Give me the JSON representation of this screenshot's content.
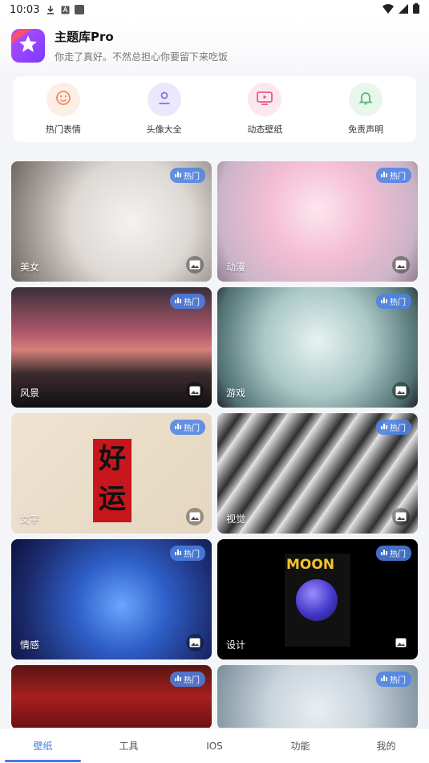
{
  "status_bar": {
    "time": "10:03"
  },
  "header": {
    "app_title": "主题库Pro",
    "subtitle": "你走了真好。不然总担心你要留下来吃饭",
    "logo_icon": "star-logo-icon"
  },
  "quick_menu": [
    {
      "label": "热门表情",
      "icon": "smiley-icon",
      "bg": "#fdeee6",
      "color": "#f08a5d"
    },
    {
      "label": "头像大全",
      "icon": "user-icon",
      "bg": "#ece8fb",
      "color": "#8a6fe0"
    },
    {
      "label": "动态壁纸",
      "icon": "tv-play-icon",
      "bg": "#fde7ee",
      "color": "#e85a86"
    },
    {
      "label": "免责声明",
      "icon": "bell-icon",
      "bg": "#e8f6ec",
      "color": "#4fbf73"
    }
  ],
  "hot_badge": "热门",
  "tiles": [
    {
      "label": "美女"
    },
    {
      "label": "动漫"
    },
    {
      "label": "风景"
    },
    {
      "label": "游戏"
    },
    {
      "label": "文字",
      "art_text": "好运"
    },
    {
      "label": "视觉"
    },
    {
      "label": "情感"
    },
    {
      "label": "设计",
      "art_text": "MOON"
    },
    {
      "label": ""
    },
    {
      "label": ""
    }
  ],
  "bottom_nav": [
    {
      "label": "壁纸",
      "active": true
    },
    {
      "label": "工具",
      "active": false
    },
    {
      "label": "IOS",
      "active": false
    },
    {
      "label": "功能",
      "active": false
    },
    {
      "label": "我的",
      "active": false
    }
  ],
  "colors": {
    "accent": "#3e7be6",
    "badge": "#4c82e6"
  }
}
